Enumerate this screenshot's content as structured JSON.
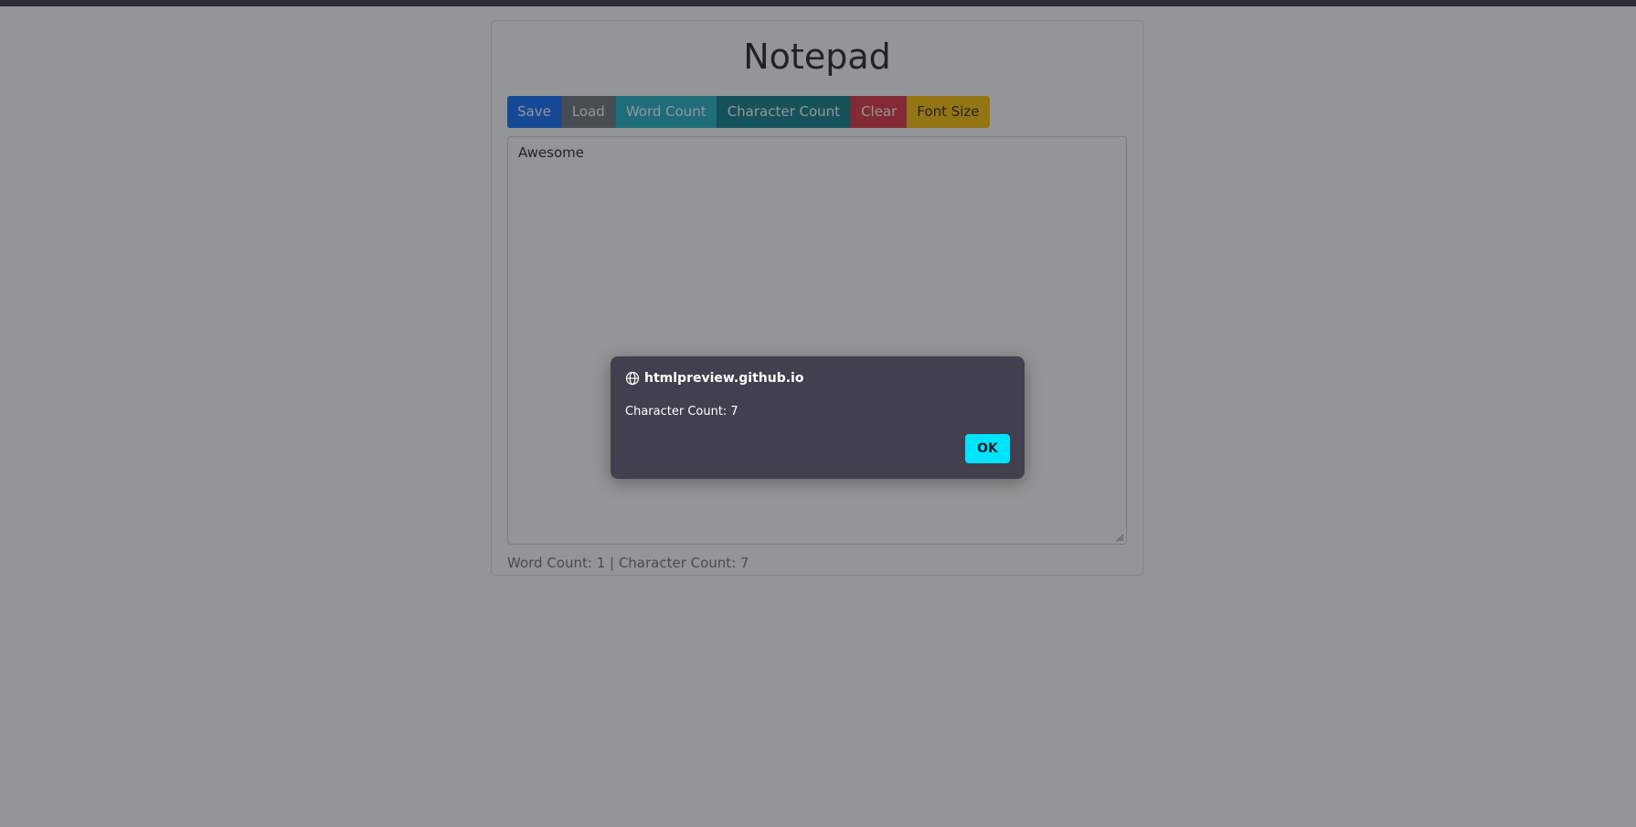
{
  "app": {
    "title": "Notepad"
  },
  "toolbar": {
    "save_label": "Save",
    "load_label": "Load",
    "word_count_label": "Word Count",
    "character_count_label": "Character Count",
    "clear_label": "Clear",
    "font_size_label": "Font Size"
  },
  "editor": {
    "value": "Awesome"
  },
  "stats": {
    "text": "Word Count: 1 | Character Count: 7"
  },
  "dialog": {
    "origin": "htmlpreview.github.io",
    "message": "Character Count: 7",
    "ok_label": "OK",
    "icon": "globe-icon"
  },
  "colors": {
    "save": "#0d6efd",
    "load": "#6c757d",
    "word_count": "#1fb3cc",
    "character_count": "#0f7f91",
    "clear": "#dc3545",
    "font_size": "#ffc107",
    "dialog_bg": "#42404f",
    "ok_button": "#00e5ff"
  }
}
